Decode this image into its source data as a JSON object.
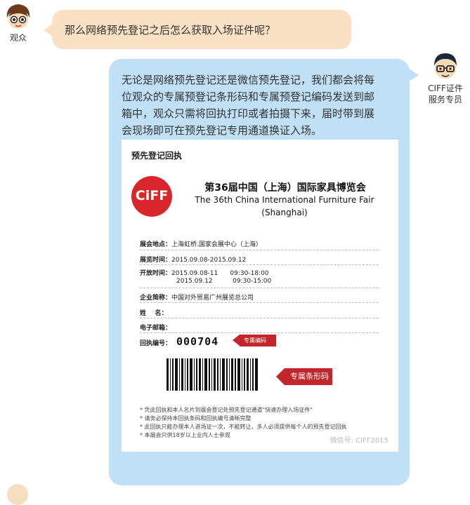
{
  "visitor": {
    "label": "观众",
    "message": "那么网络预先登记之后怎么获取入场证件呢？"
  },
  "agent": {
    "label_line1": "CIFF证件",
    "label_line2": "服务专员",
    "message_lines": [
      "无论是网络预先登记还是微信预先登记，我们都会将每",
      "位观众的专属预登记条形码和专属预登记编码发送到邮",
      "箱中，观众只需将回执打印或者拍摄下来，届时带到展",
      "会现场即可在预先登记专用通道换证入场。"
    ]
  },
  "ticket": {
    "heading": "预先登记回执",
    "logo_text": "CiFF",
    "title_cn": "第36届中国（上海）国际家具博览会",
    "title_en_line1": "The 36th China International Furniture Fair",
    "title_en_line2": "(Shanghai)",
    "venue_label": "展会地点：",
    "venue_value": "上海虹桥.国家会展中心（上海）",
    "dates_label": "展览时间：",
    "dates_value": "2015.09.08-2015.09.12",
    "hours_label": "开放时间：",
    "hours_row1": "2015.09.08-11      09:30-18:00",
    "hours_row2": "2015.09.12          09:30-15:00",
    "company_label": "企业简称：",
    "company_value": "中国对外贸易广州展览总公司",
    "name_label": "姓    名：",
    "email_label": "电子邮箱：",
    "receipt_label": "回执编号：",
    "receipt_number": "000704",
    "receipt_tag": "专属编码",
    "barcode_tag": "专属条形码",
    "notes": [
      "* 凭此回执和本人名片到展会登记处预先登记通道\"快速办理入场证件\"",
      "* 请务必保持本回执条码和回执编号清晰完整",
      "* 此回执只能办理本人进场证一次，不能转让，多人必须提供每个人的预先登记回执",
      "* 本展会只供18岁以上业内人士参观"
    ],
    "watermark": "微信号: CIFF2015"
  },
  "colors": {
    "visitor_bubble": "#fbe1c4",
    "agent_bubble": "#bfe0f5",
    "brand_red": "#d9262c"
  }
}
